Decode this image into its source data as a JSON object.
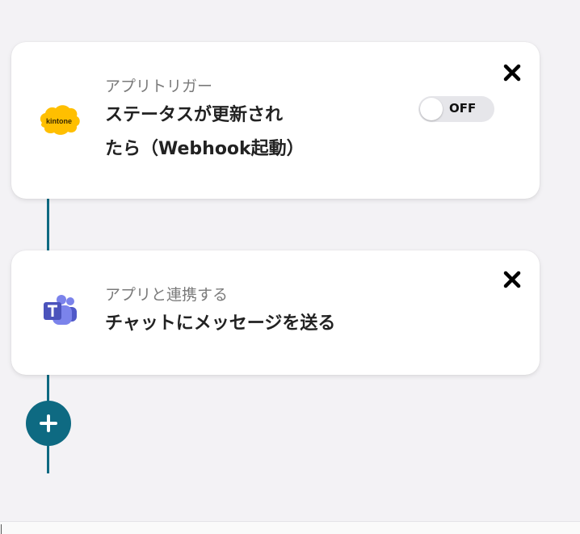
{
  "colors": {
    "background": "#f3f2f5",
    "accent": "#0e6a82",
    "card": "#ffffff",
    "toggle_off": "#e6e6ea",
    "kintone_yellow": "#ffbf00",
    "teams_purple": "#5059c9"
  },
  "steps": [
    {
      "icon": "kintone-logo",
      "subtitle": "アプリトリガー",
      "title_line1": "ステータスが更新され",
      "title_line2": "たら（Webhook起動）",
      "toggle_label": "OFF",
      "toggle_on": false,
      "close_icon": "close-x-icon"
    },
    {
      "icon": "microsoft-teams-logo",
      "subtitle": "アプリと連携する",
      "title_line1": "チャットにメッセージを送る",
      "close_icon": "close-x-icon"
    }
  ],
  "add_step": {
    "icon": "plus-icon"
  }
}
